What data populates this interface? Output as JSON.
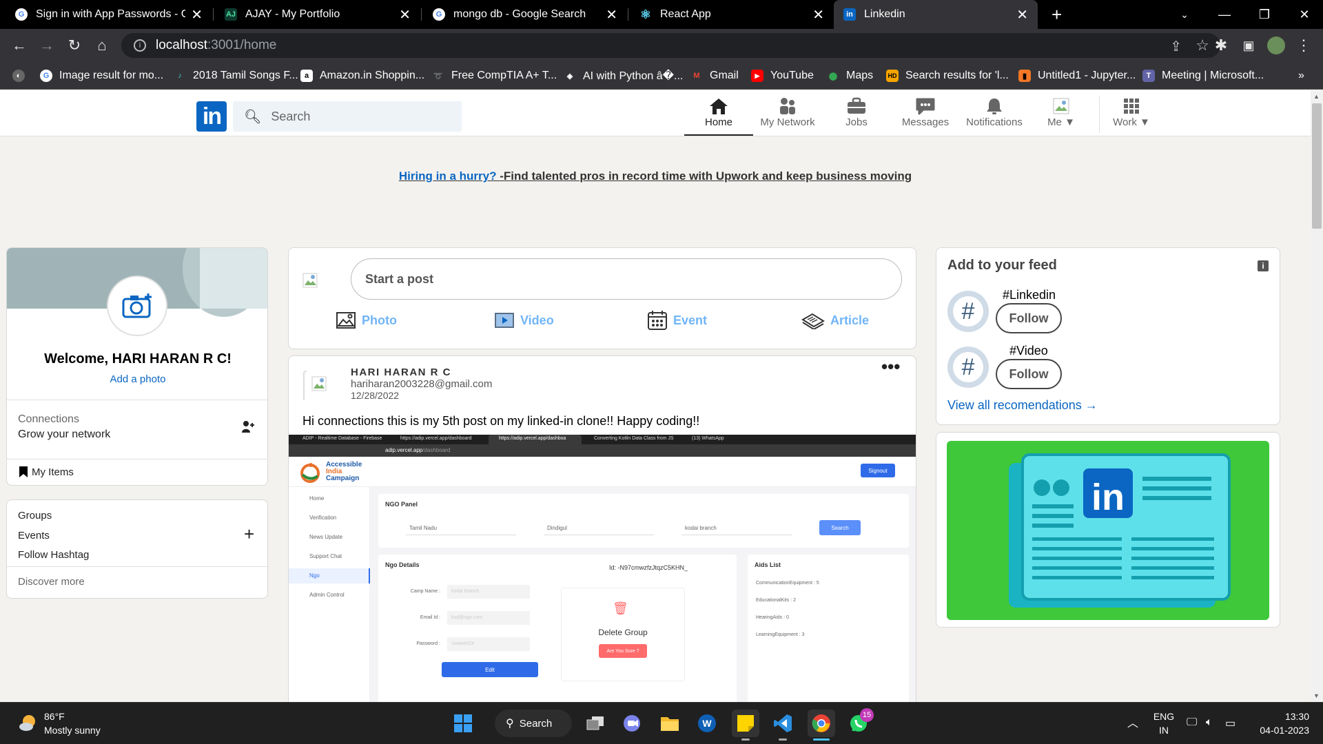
{
  "browser": {
    "tabs": [
      {
        "title": "Sign in with App Passwords - Gm",
        "icon": "google-icon",
        "active": false
      },
      {
        "title": "AJAY - My Portfolio",
        "icon": "aj-icon",
        "active": false
      },
      {
        "title": "mongo db - Google Search",
        "icon": "google-icon",
        "active": false
      },
      {
        "title": "React App",
        "icon": "react-icon",
        "active": false
      },
      {
        "title": "Linkedin",
        "icon": "linkedin-icon",
        "active": true
      }
    ],
    "address": {
      "host": "localhost",
      "path": ":3001/home"
    },
    "bookmarks": [
      {
        "label": "Image result for mo...",
        "icon": "google-icon"
      },
      {
        "label": "2018 Tamil Songs F...",
        "icon": "music-icon"
      },
      {
        "label": "Amazon.in Shoppin...",
        "icon": "amazon-icon"
      },
      {
        "label": "Free CompTIA A+ T...",
        "icon": "link-icon"
      },
      {
        "label": "AI with Python â�...",
        "icon": "ai-icon"
      },
      {
        "label": "Gmail",
        "icon": "gmail-icon"
      },
      {
        "label": "YouTube",
        "icon": "youtube-icon"
      },
      {
        "label": "Maps",
        "icon": "maps-icon"
      },
      {
        "label": "Search results for 'l...",
        "icon": "hd-icon"
      },
      {
        "label": "Untitled1 - Jupyter...",
        "icon": "jupyter-icon"
      },
      {
        "label": "Meeting | Microsoft...",
        "icon": "teams-icon"
      }
    ],
    "bookmarks_more": "»"
  },
  "linkedin": {
    "logo": "in",
    "search_placeholder": "Search",
    "nav": [
      {
        "label": "Home",
        "icon": "home-icon",
        "active": true
      },
      {
        "label": "My Network",
        "icon": "network-icon",
        "active": false
      },
      {
        "label": "Jobs",
        "icon": "briefcase-icon",
        "active": false
      },
      {
        "label": "Messages",
        "icon": "messages-icon",
        "active": false
      },
      {
        "label": "Notifications",
        "icon": "bell-icon",
        "active": false
      },
      {
        "label": "Me",
        "icon": "avatar-icon",
        "active": false
      },
      {
        "label": "Work",
        "icon": "grid-icon",
        "active": false
      }
    ],
    "promo": {
      "link": "Hiring in a hurry? ",
      "text": "-Find talented pros in record time with Upwork and keep business moving"
    },
    "profile": {
      "welcome": "Welcome, HARI HARAN R C!",
      "add_photo": "Add a photo",
      "connections_label": "Connections",
      "grow_network": "Grow your network",
      "my_items": "My Items",
      "groups": "Groups",
      "events": "Events",
      "follow_hashtag": "Follow Hashtag",
      "discover_more": "Discover more"
    },
    "composer": {
      "placeholder": "Start a post",
      "actions": [
        {
          "label": "Photo",
          "icon": "photo-icon"
        },
        {
          "label": "Video",
          "icon": "video-icon"
        },
        {
          "label": "Event",
          "icon": "calendar-icon"
        },
        {
          "label": "Article",
          "icon": "article-icon"
        }
      ]
    },
    "post": {
      "author": "HARI HARAN R C",
      "email": "hariharan2003228@gmail.com",
      "date": "12/28/2022",
      "text": "Hi connections this is my 5th post on my linked-in clone!! Happy coding!!",
      "more": "•••"
    },
    "feed": {
      "title": "Add to your feed",
      "items": [
        {
          "tag": "#Linkedin",
          "button": "Follow"
        },
        {
          "tag": "#Video",
          "button": "Follow"
        }
      ],
      "view_all": "View all recomendations"
    }
  },
  "screenshot_in_post": {
    "tabs": [
      "ADIP - Realtime Database - Firebase",
      "https://adip.vercel.app/dashboard",
      "https://adip.vercel.app/dashboa",
      "Converting Kotlin Data Class from JS",
      "(13) WhatsApp"
    ],
    "url_host": "adip.vercel.app",
    "url_path": "/dashboard",
    "brand": [
      "Accessible",
      "India",
      "Campaign"
    ],
    "signout": "Signout",
    "sidebar": [
      "Home",
      "Verification",
      "News Update",
      "Support Chat",
      "Ngo",
      "Admin Control"
    ],
    "panel_title": "NGO Panel",
    "filters": [
      "Tamil Nadu",
      "Dindigul",
      "kodai branch"
    ],
    "search_btn": "Search",
    "details_title": "Ngo Details",
    "ngo_id": "Id: -N97cmwzfzJtqzC5KHN_",
    "fields": [
      {
        "label": "Camp Name :",
        "value": "kodai branch"
      },
      {
        "label": "Email Id :",
        "value": "kod@ngo.com"
      },
      {
        "label": "Password :",
        "value": "1wqwe22e"
      }
    ],
    "edit_btn": "Edit",
    "delete_title": "Delete Group",
    "delete_btn": "Are You Sure ?",
    "aids_title": "Aids List",
    "aids": [
      "CommunicationEquipment : 5",
      "EducationalKits : 2",
      "HearingAids : 0",
      "LearningEquipment : 3"
    ]
  },
  "taskbar": {
    "weather_temp": "86°F",
    "weather_desc": "Mostly sunny",
    "search": "Search",
    "whatsapp_badge": "15",
    "lang": "ENG",
    "region": "IN",
    "time": "13:30",
    "date": "04-01-2023"
  }
}
